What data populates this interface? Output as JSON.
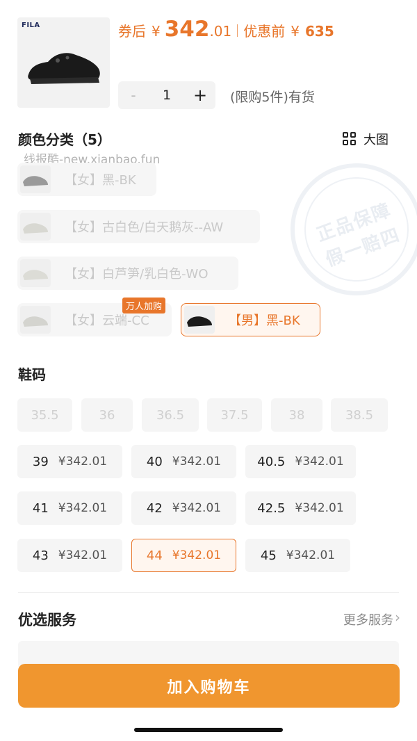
{
  "product": {
    "brand_text": "FILA",
    "coupon_label": "券后",
    "currency": "¥",
    "coupon_price_int": "342",
    "coupon_price_dec": ".01",
    "original_label": "优惠前",
    "original_price": "635",
    "quantity": "1",
    "minus": "-",
    "plus": "+",
    "stock_text": "(限购5件)有货"
  },
  "color_section": {
    "title": "颜色分类（5）",
    "big_pic_label": "大图",
    "watermark": "线报酷-new.xianbao.fun",
    "options": [
      {
        "label": "【女】黑-BK",
        "state": "disabled"
      },
      {
        "label": "【女】古白色/白天鹅灰--AW",
        "state": "disabled"
      },
      {
        "label": "【女】白芦笋/乳白色-WO",
        "state": "disabled"
      },
      {
        "label": "【女】云端-CC",
        "state": "disabled"
      },
      {
        "label": "【男】黑-BK",
        "state": "selected"
      }
    ],
    "badge": "万人加购"
  },
  "stamp": {
    "line1": "正品保障",
    "line2": "假一赔四"
  },
  "size_section": {
    "title": "鞋码",
    "disabled_sizes": [
      "35.5",
      "36",
      "36.5",
      "37.5",
      "38",
      "38.5"
    ],
    "sizes": [
      {
        "size": "39",
        "price": "¥342.01"
      },
      {
        "size": "40",
        "price": "¥342.01"
      },
      {
        "size": "40.5",
        "price": "¥342.01"
      },
      {
        "size": "41",
        "price": "¥342.01"
      },
      {
        "size": "42",
        "price": "¥342.01"
      },
      {
        "size": "42.5",
        "price": "¥342.01"
      },
      {
        "size": "43",
        "price": "¥342.01"
      },
      {
        "size": "44",
        "price": "¥342.01",
        "selected": true
      },
      {
        "size": "45",
        "price": "¥342.01"
      }
    ]
  },
  "services": {
    "title": "优选服务",
    "more": "更多服务",
    "more_icon": "chevron-right-icon"
  },
  "cta": {
    "label": "加入购物车"
  },
  "colors": {
    "accent": "#e8762b",
    "cta": "#f0962f"
  }
}
